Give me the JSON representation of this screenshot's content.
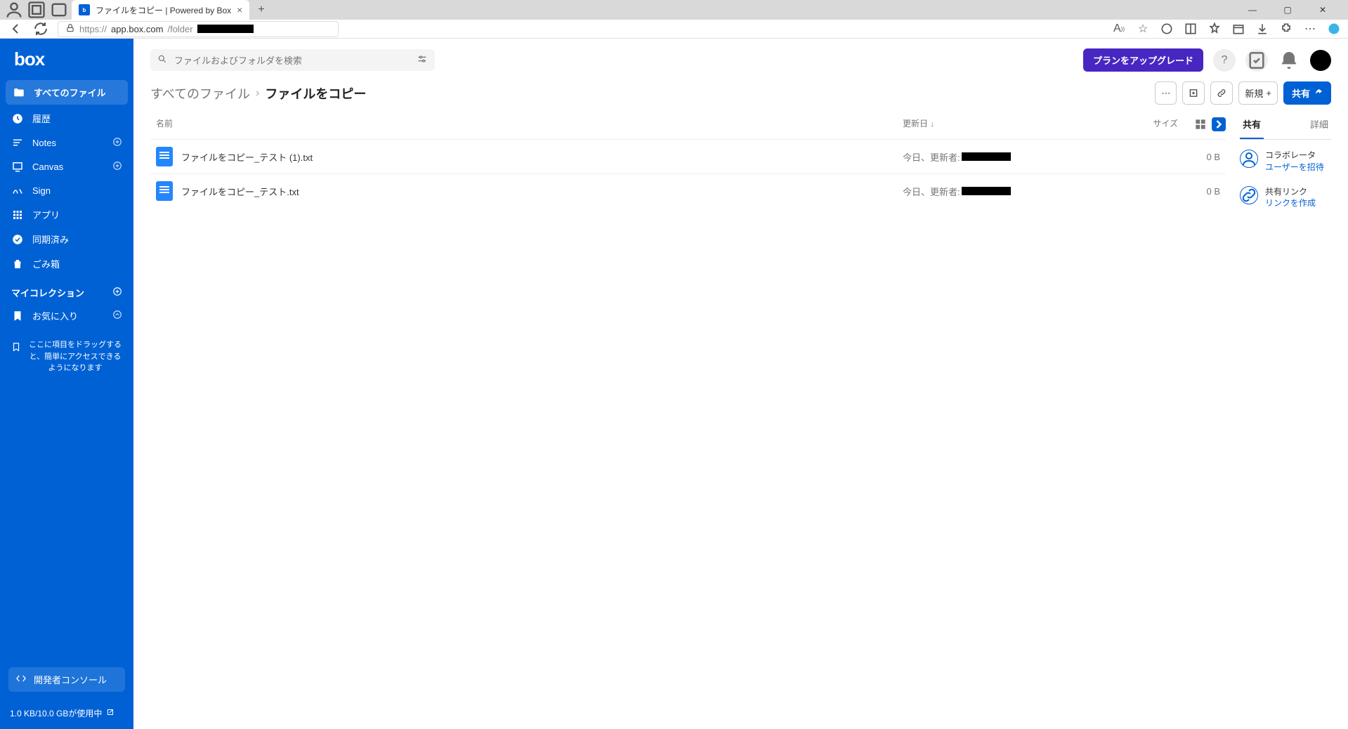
{
  "browser": {
    "tab_title": "ファイルをコピー | Powered by Box",
    "url_host": "app.box.com",
    "url_path": "/folder"
  },
  "sidebar": {
    "logo": "box",
    "items": [
      {
        "label": "すべてのファイル",
        "icon": "folder-icon",
        "active": true
      },
      {
        "label": "履歴",
        "icon": "clock-icon"
      },
      {
        "label": "Notes",
        "icon": "notes-icon",
        "add": true
      },
      {
        "label": "Canvas",
        "icon": "canvas-icon",
        "add": true
      },
      {
        "label": "Sign",
        "icon": "sign-icon"
      },
      {
        "label": "アプリ",
        "icon": "apps-icon"
      },
      {
        "label": "同期済み",
        "icon": "sync-icon"
      },
      {
        "label": "ごみ箱",
        "icon": "trash-icon"
      }
    ],
    "collection_label": "マイコレクション",
    "favorites_label": "お気に入り",
    "drag_hint": "ここに項目をドラッグすると、簡単にアクセスできるようになります",
    "dev_console": "開発者コンソール",
    "storage": "1.0 KB/10.0 GBが使用中"
  },
  "header": {
    "search_placeholder": "ファイルおよびフォルダを検索",
    "upgrade": "プランをアップグレード"
  },
  "breadcrumb": {
    "root": "すべてのファイル",
    "current": "ファイルをコピー",
    "new_btn": "新規",
    "share_btn": "共有"
  },
  "list": {
    "col_name": "名前",
    "col_date": "更新日",
    "col_size": "サイズ",
    "rows": [
      {
        "name": "ファイルをコピー_テスト (1).txt",
        "date_prefix": "今日、更新者:",
        "size": "0 B"
      },
      {
        "name": "ファイルをコピー_テスト.txt",
        "date_prefix": "今日、更新者:",
        "size": "0 B"
      }
    ]
  },
  "panel": {
    "tab_share": "共有",
    "tab_detail": "詳細",
    "collab_title": "コラボレータ",
    "collab_link": "ユーザーを招待",
    "link_title": "共有リンク",
    "link_link": "リンクを作成"
  }
}
